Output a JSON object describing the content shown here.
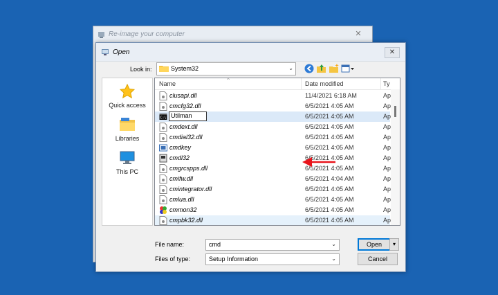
{
  "background_window": {
    "title": "Re-image your computer",
    "close": "✕"
  },
  "dialog": {
    "title": "Open",
    "close": "✕",
    "look_in": {
      "label": "Look in:",
      "value": "System32"
    },
    "toolbar": [
      "back-icon",
      "up-folder-icon",
      "new-folder-icon",
      "view-menu-icon"
    ],
    "places": [
      {
        "label": "Quick access",
        "icon": "star-icon"
      },
      {
        "label": "Libraries",
        "icon": "libraries-icon"
      },
      {
        "label": "This PC",
        "icon": "computer-icon"
      }
    ],
    "columns": {
      "name": "Name",
      "date": "Date modified",
      "type": "Ty"
    },
    "files": [
      {
        "name": "clusapi.dll",
        "date": "11/4/2021 6:18 AM",
        "type": "Ap"
      },
      {
        "name": "cmcfg32.dll",
        "date": "6/5/2021 4:05 AM",
        "type": "Ap"
      },
      {
        "name": "Utilman",
        "date": "6/5/2021 4:05 AM",
        "type": "Ap"
      },
      {
        "name": "cmdext.dll",
        "date": "6/5/2021 4:05 AM",
        "type": "Ap"
      },
      {
        "name": "cmdial32.dll",
        "date": "6/5/2021 4:05 AM",
        "type": "Ap"
      },
      {
        "name": "cmdkey",
        "date": "6/5/2021 4:05 AM",
        "type": "Ap"
      },
      {
        "name": "cmdl32",
        "date": "6/5/2021 4:05 AM",
        "type": "Ap"
      },
      {
        "name": "cmgrcspps.dll",
        "date": "6/5/2021 4:05 AM",
        "type": "Ap"
      },
      {
        "name": "cmifw.dll",
        "date": "6/5/2021 4:04 AM",
        "type": "Ap"
      },
      {
        "name": "cmintegrator.dll",
        "date": "6/5/2021 4:05 AM",
        "type": "Ap"
      },
      {
        "name": "cmlua.dll",
        "date": "6/5/2021 4:05 AM",
        "type": "Ap"
      },
      {
        "name": "cmmon32",
        "date": "6/5/2021 4:05 AM",
        "type": "Ap"
      },
      {
        "name": "cmpbk32.dll",
        "date": "6/5/2021 4:05 AM",
        "type": "Ap"
      }
    ],
    "file_name": {
      "label": "File name:",
      "value": "cmd"
    },
    "files_of_type": {
      "label": "Files of type:",
      "value": "Setup Information"
    },
    "open_button": "Open",
    "cancel_button": "Cancel"
  },
  "colors": {
    "desktop": "#1a63b3",
    "selection": "#dbe9f8",
    "annotation_arrow": "#e8141b"
  }
}
